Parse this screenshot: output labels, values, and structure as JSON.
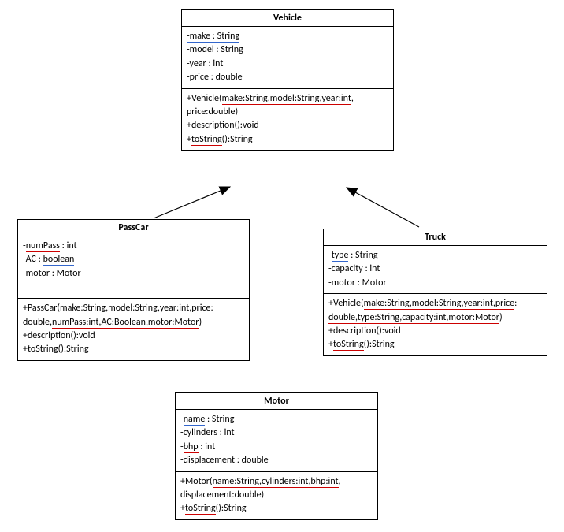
{
  "vehicle": {
    "name": "Vehicle",
    "attrs": {
      "make": "-make : String",
      "model": "-model : String",
      "year": "-year : int",
      "price": "-price : double"
    },
    "methods": {
      "ctor_pre": "+Vehicle(",
      "ctor_mid": "make:String,model:String,year:int",
      "ctor_post": ",",
      "ctor_line2": "price:double)",
      "desc": "+description():void",
      "tostr_pre": "+",
      "tostr_mid": "toString",
      "tostr_post": "():String"
    }
  },
  "passcar": {
    "name": "PassCar",
    "attrs": {
      "numpass_pre": "-",
      "numpass_mid": "numPass",
      "numpass_post": " : int",
      "ac_pre": "-AC : ",
      "ac_mid": "boolean",
      "motor": "-motor : Motor"
    },
    "methods": {
      "ctor_pre": "+",
      "ctor_mid": "PassCar(make:String,model:String,year:int,price",
      "ctor_post": ":",
      "ctor_line2_pre": "double,",
      "ctor_line2_mid": "numPass:int,AC:Boolean,motor:Motor",
      "ctor_line2_post": ")",
      "desc": "+description():void",
      "tostr_pre": "+",
      "tostr_mid": "toString",
      "tostr_post": "():String"
    }
  },
  "truck": {
    "name": "Truck",
    "attrs": {
      "type_pre": "-",
      "type_mid": "type",
      "type_post": " : String",
      "capacity": "-capacity : int",
      "motor": "-motor : Motor"
    },
    "methods": {
      "ctor_pre": "+Vehicle(",
      "ctor_mid": "make:String,model:String,year:int,price",
      "ctor_post": ":",
      "ctor_line2_pre": "",
      "ctor_line2_mid": "double,type:String,capacity:int,motor:Motor",
      "ctor_line2_post": ")",
      "desc": "+description():void",
      "tostr_pre": "+",
      "tostr_mid": "toString",
      "tostr_post": "():String"
    }
  },
  "motor": {
    "name": "Motor",
    "attrs": {
      "name_pre": "-",
      "name_mid": "name",
      "name_post": " : String",
      "cyl": "-cylinders : int",
      "bhp_pre": "-",
      "bhp_mid": "bhp",
      "bhp_post": " : int",
      "disp": "-displacement : double"
    },
    "methods": {
      "ctor_pre": "+Motor(",
      "ctor_mid": "name:String,cylinders:int,bhp:int",
      "ctor_post": ",",
      "ctor_line2": "displacement:double)",
      "tostr_pre": "+",
      "tostr_mid": "toString",
      "tostr_post": "():String"
    }
  }
}
